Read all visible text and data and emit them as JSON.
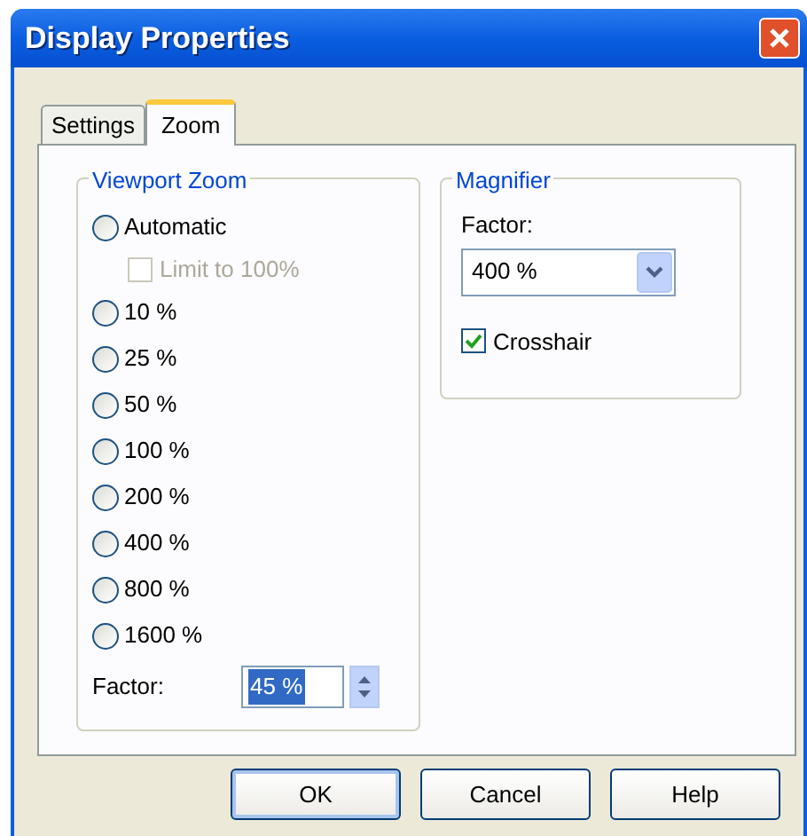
{
  "window": {
    "title": "Display Properties"
  },
  "tabs": [
    {
      "label": "Settings",
      "selected": false
    },
    {
      "label": "Zoom",
      "selected": true
    }
  ],
  "viewport_zoom": {
    "title": "Viewport Zoom",
    "options": [
      {
        "kind": "radio",
        "label": "Automatic",
        "selected": false
      },
      {
        "kind": "checkbox",
        "label": "Limit to 100%",
        "checked": false,
        "disabled": true
      },
      {
        "kind": "radio",
        "label": "10 %",
        "selected": false
      },
      {
        "kind": "radio",
        "label": "25 %",
        "selected": false
      },
      {
        "kind": "radio",
        "label": "50 %",
        "selected": false
      },
      {
        "kind": "radio",
        "label": "100 %",
        "selected": false
      },
      {
        "kind": "radio",
        "label": "200 %",
        "selected": false
      },
      {
        "kind": "radio",
        "label": "400 %",
        "selected": false
      },
      {
        "kind": "radio",
        "label": "800 %",
        "selected": false
      },
      {
        "kind": "radio",
        "label": "1600 %",
        "selected": false
      }
    ],
    "factor": {
      "label": "Factor:",
      "value": "45 %"
    }
  },
  "magnifier": {
    "title": "Magnifier",
    "factor_label": "Factor:",
    "factor_value": "400 %",
    "crosshair": {
      "label": "Crosshair",
      "checked": true
    }
  },
  "buttons": [
    {
      "label": "OK",
      "default": true
    },
    {
      "label": "Cancel",
      "default": false
    },
    {
      "label": "Help",
      "default": false
    }
  ]
}
